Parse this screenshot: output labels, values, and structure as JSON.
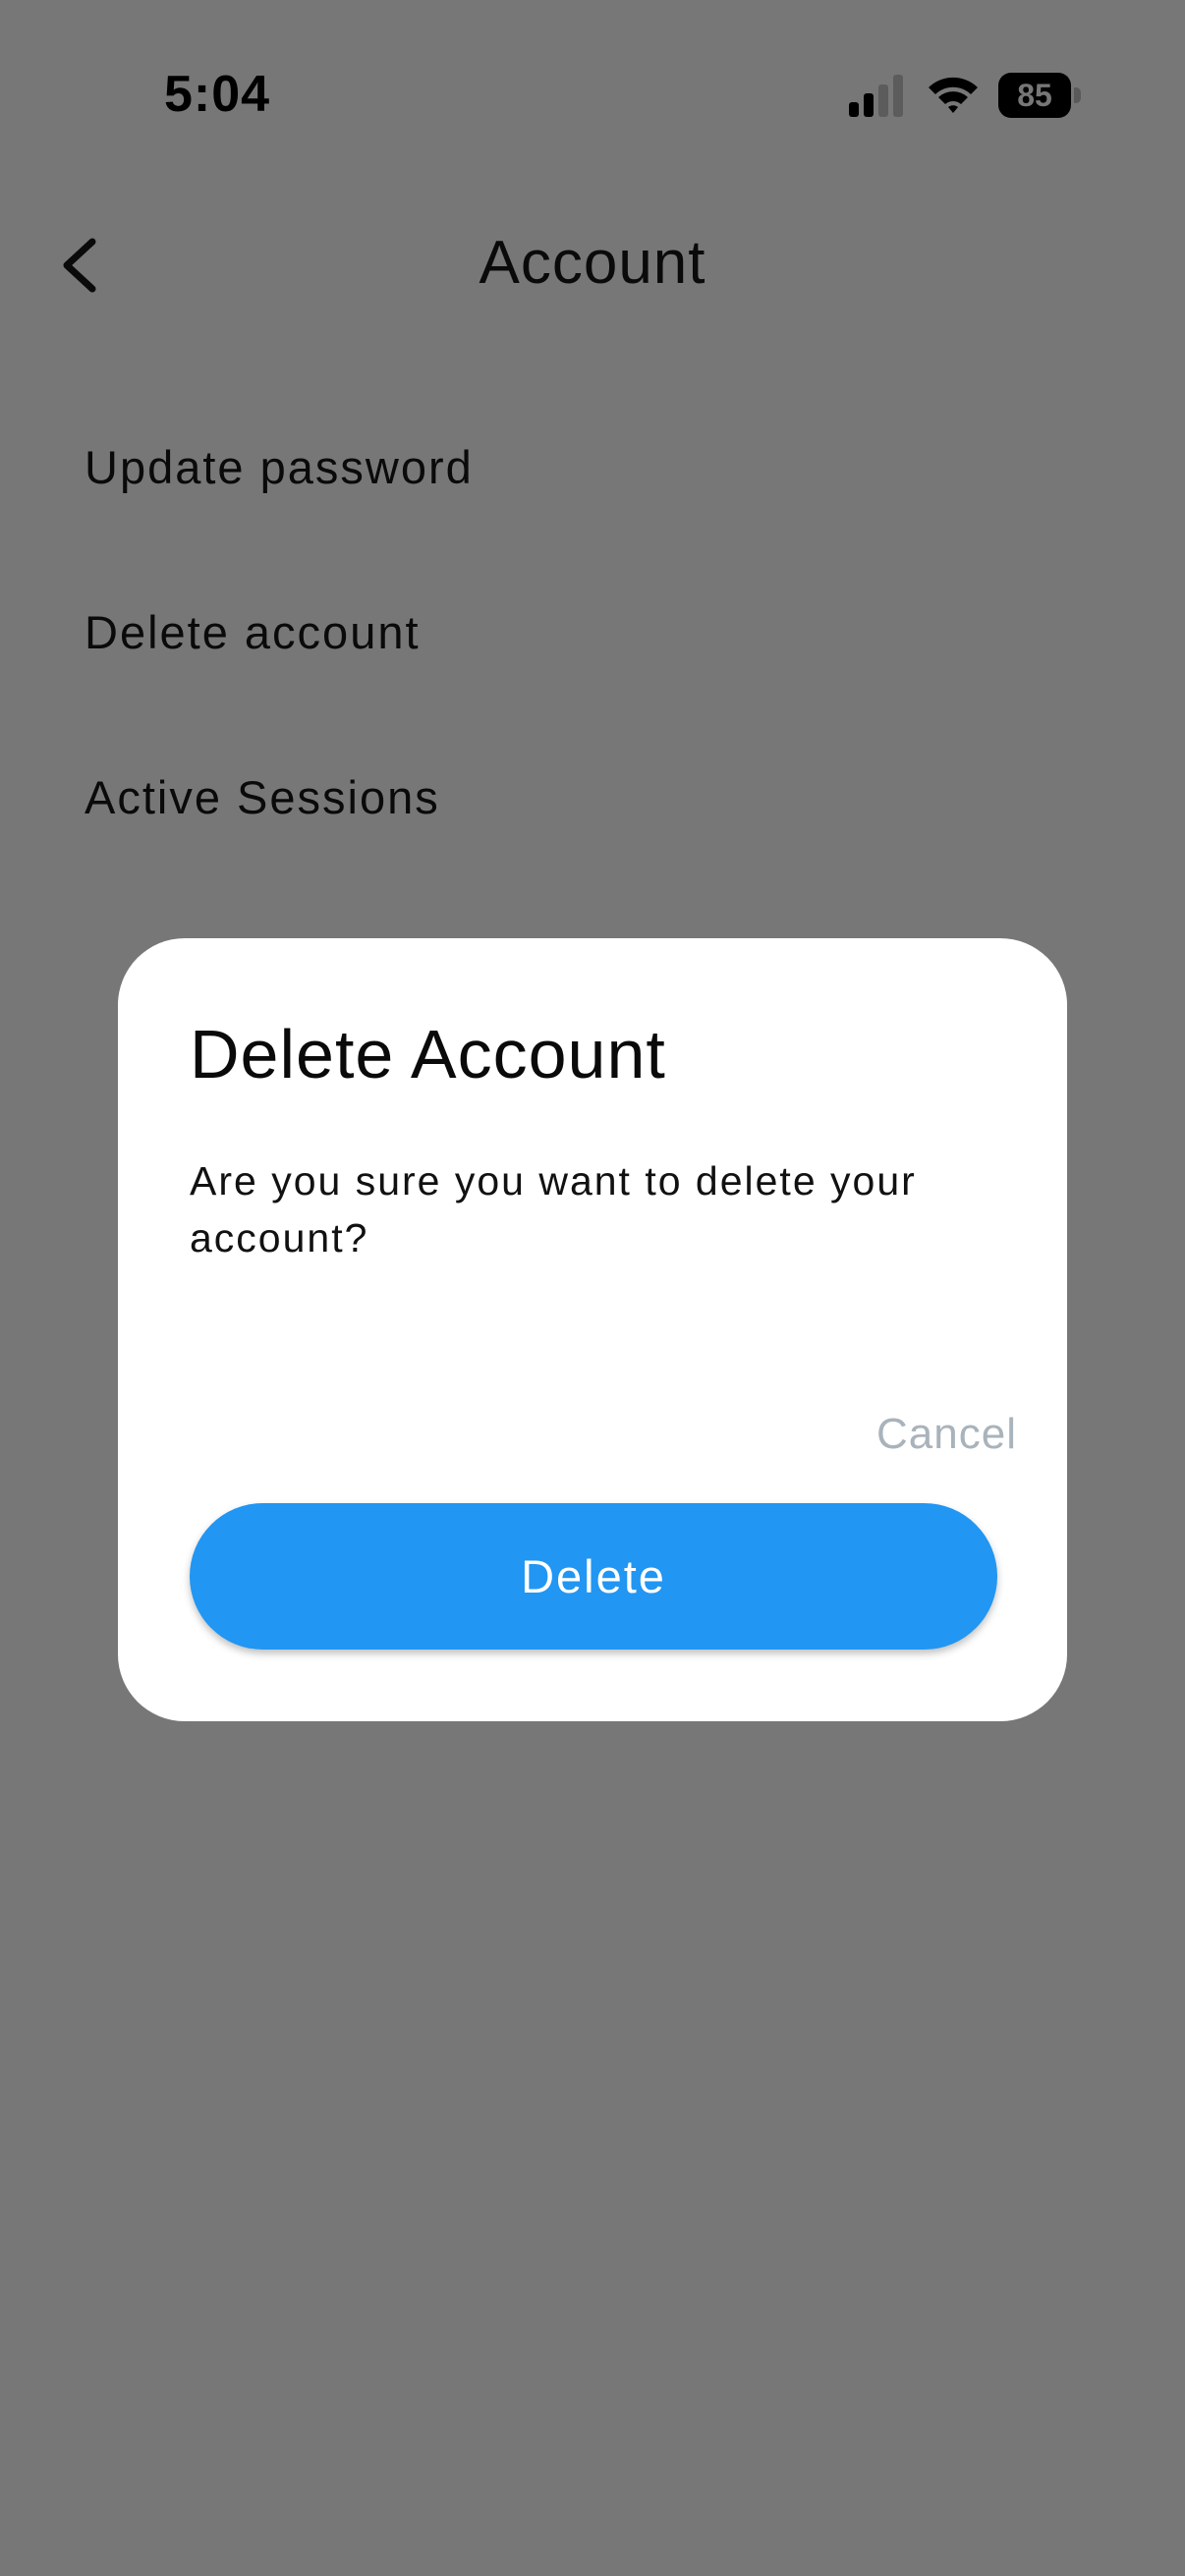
{
  "status_bar": {
    "time": "5:04",
    "battery_level": "85",
    "icons": [
      "cellular-signal-icon",
      "wifi-icon",
      "battery-icon"
    ]
  },
  "header": {
    "back_icon": "chevron-left-icon",
    "title": "Account"
  },
  "menu": {
    "items": [
      {
        "label": "Update password"
      },
      {
        "label": "Delete account"
      },
      {
        "label": "Active Sessions"
      }
    ]
  },
  "dialog": {
    "title": "Delete Account",
    "message": "Are you sure you want to delete your account?",
    "cancel_label": "Cancel",
    "delete_label": "Delete"
  },
  "colors": {
    "overlay_background": "#777777",
    "dialog_background": "#ffffff",
    "primary_button": "#2196f3",
    "cancel_text": "#a9b3bb"
  }
}
